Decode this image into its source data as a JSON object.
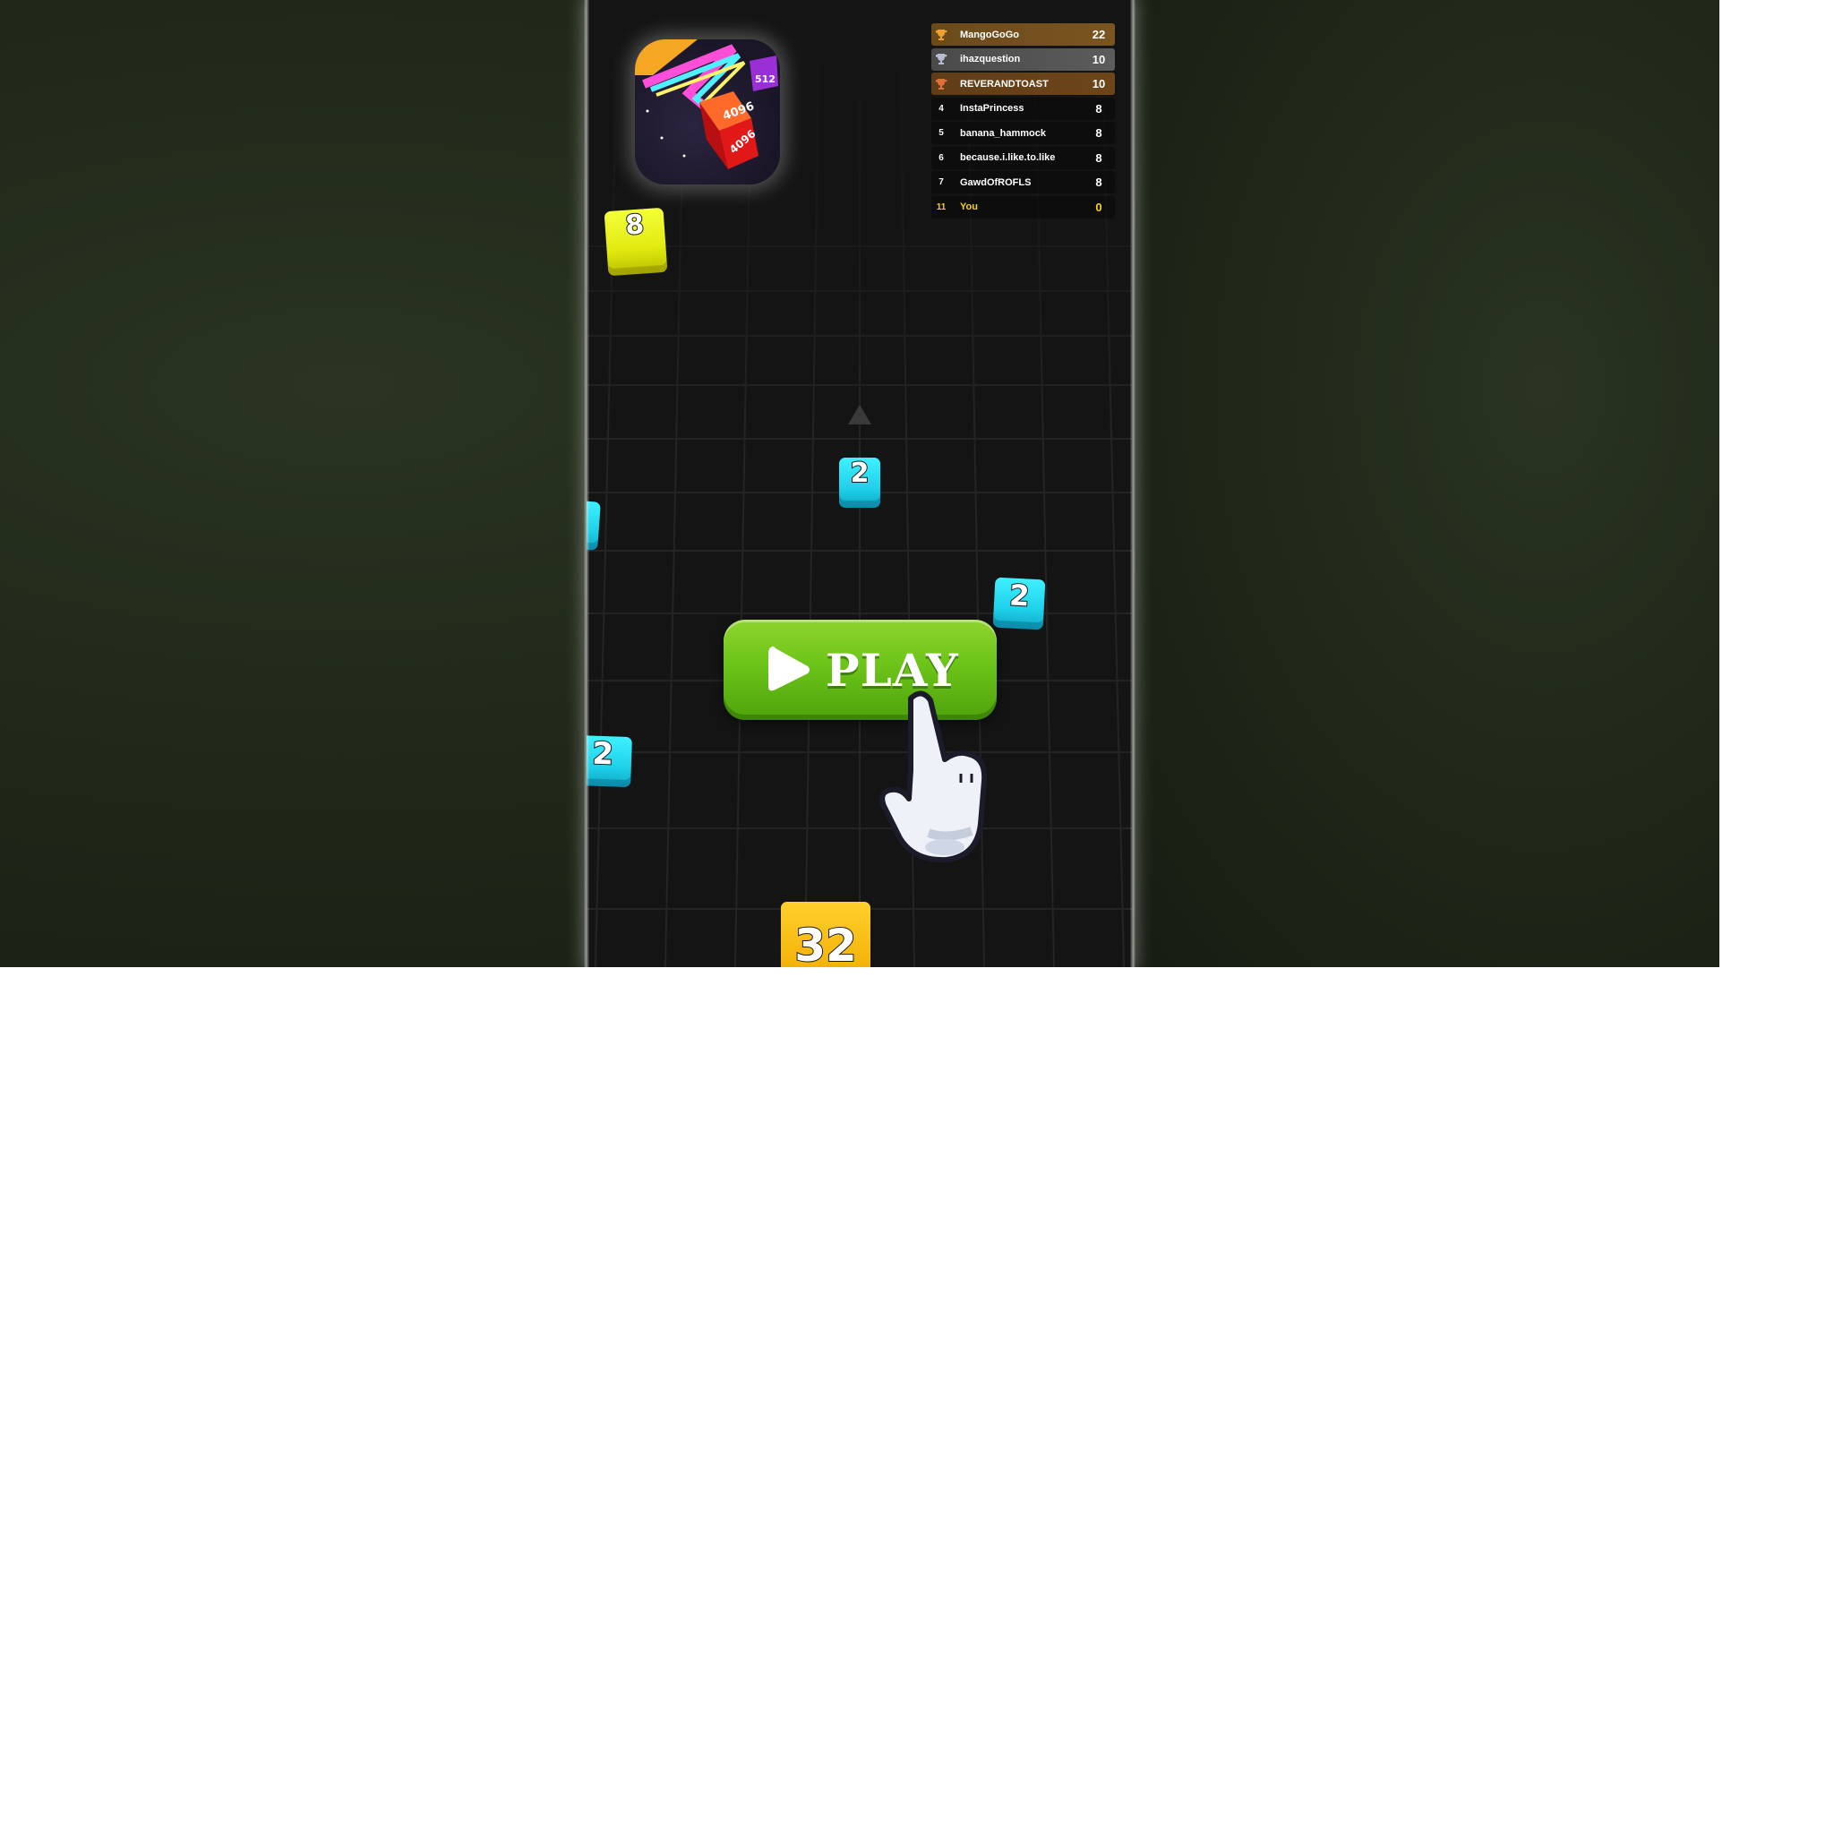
{
  "leaderboard": [
    {
      "rank": "",
      "medal": "gold-trophy-icon",
      "name": "MangoGoGo",
      "score": "22"
    },
    {
      "rank": "",
      "medal": "silver-trophy-icon",
      "name": "ihazquestion",
      "score": "10"
    },
    {
      "rank": "",
      "medal": "bronze-trophy-icon",
      "name": "REVERANDTOAST",
      "score": "10"
    },
    {
      "rank": "4",
      "name": "InstaPrincess",
      "score": "8"
    },
    {
      "rank": "5",
      "name": "banana_hammock",
      "score": "8"
    },
    {
      "rank": "6",
      "name": "because.i.like.to.like",
      "score": "8"
    },
    {
      "rank": "7",
      "name": "GawdOfROFLS",
      "score": "8"
    },
    {
      "rank": "11",
      "name": "You",
      "score": "0"
    }
  ],
  "app_icon": {
    "cube_labels": [
      "4096",
      "4096",
      "512"
    ]
  },
  "cubes": [
    {
      "value": "8",
      "color": "yellow"
    },
    {
      "value": "2",
      "color": "cyan"
    },
    {
      "value": "2",
      "color": "cyan"
    },
    {
      "value": "2",
      "color": "cyan"
    },
    {
      "value": "32",
      "color": "gold"
    }
  ],
  "play_button": {
    "label": "PLAY"
  },
  "colors": {
    "play_green": "#6cc419",
    "cyan_cube": "#1fd2ea",
    "yellow_cube": "#e2ea10",
    "gold_cube": "#f4b40a",
    "you_highlight": "#f4d21a",
    "background": "#1e2618",
    "board": "#141414"
  }
}
